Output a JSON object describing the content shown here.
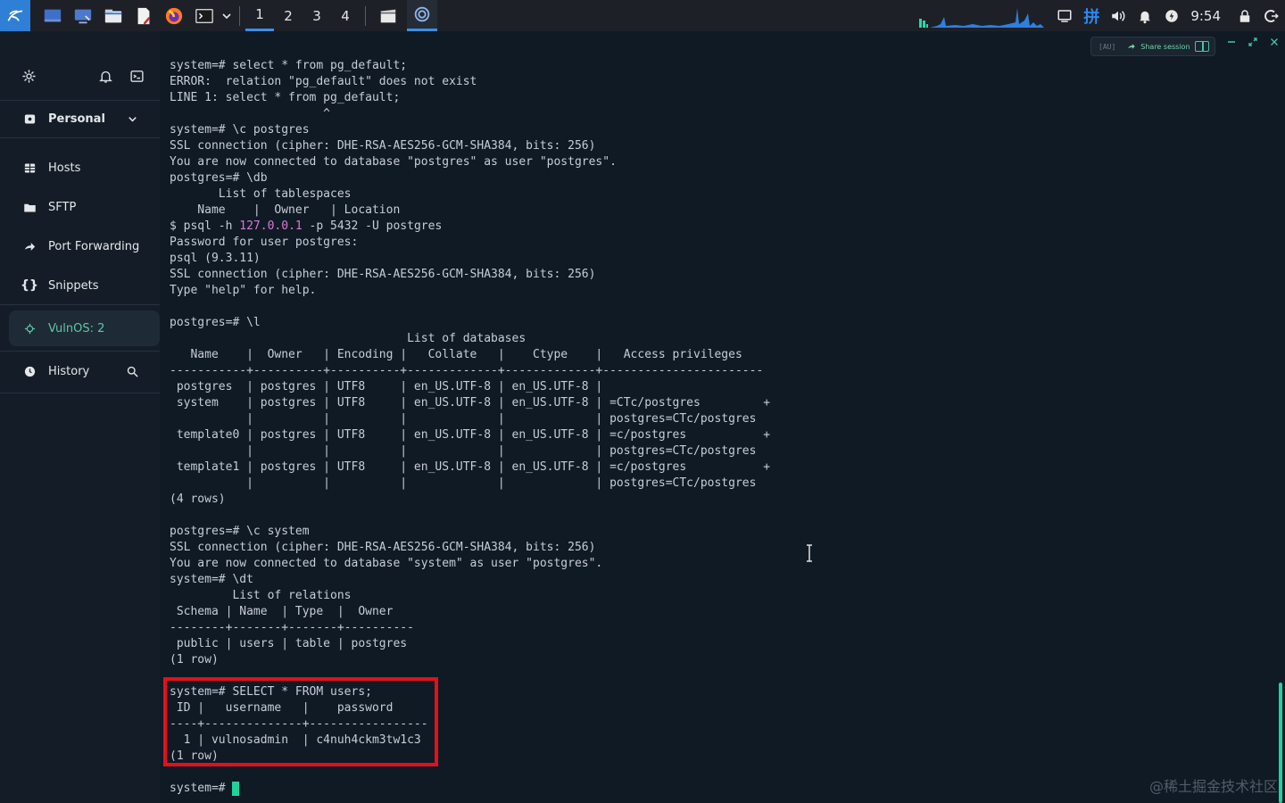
{
  "taskbar": {
    "workspaces": [
      "1",
      "2",
      "3",
      "4"
    ],
    "active_workspace": "1",
    "clock": "9:54",
    "ime_indicator": "拼",
    "accent": "#3d8ee6"
  },
  "sidebar": {
    "vault": "Personal",
    "items": [
      {
        "label": "Hosts",
        "icon": "hosts-grid-icon"
      },
      {
        "label": "SFTP",
        "icon": "folder-icon"
      },
      {
        "label": "Port Forwarding",
        "icon": "forward-arrow-icon"
      },
      {
        "label": "Snippets",
        "icon": "braces-icon"
      }
    ],
    "active_session": "VulnOS: 2",
    "history": "History",
    "active_color": "#5fc6a2"
  },
  "terminal": {
    "share_tag": "[AU]",
    "share_label": "Share session",
    "lines": [
      "system=# select * from pg_default;",
      "ERROR:  relation \"pg_default\" does not exist",
      "LINE 1: select * from pg_default;",
      "                      ^",
      "system=# \\c postgres",
      "SSL connection (cipher: DHE-RSA-AES256-GCM-SHA384, bits: 256)",
      "You are now connected to database \"postgres\" as user \"postgres\".",
      "postgres=# \\db",
      "       List of tablespaces",
      "    Name    |  Owner   | Location",
      "$ psql -h |127.0.0.1| -p 5432 -U postgres",
      "Password for user postgres:",
      "psql (9.3.11)",
      "SSL connection (cipher: DHE-RSA-AES256-GCM-SHA384, bits: 256)",
      "Type \"help\" for help.",
      "",
      "postgres=# \\l",
      "                                  List of databases",
      "   Name    |  Owner   | Encoding |   Collate   |    Ctype    |   Access privileges",
      "-----------+----------+----------+-------------+-------------+-----------------------",
      " postgres  | postgres | UTF8     | en_US.UTF-8 | en_US.UTF-8 |",
      " system    | postgres | UTF8     | en_US.UTF-8 | en_US.UTF-8 | =CTc/postgres         +",
      "           |          |          |             |             | postgres=CTc/postgres",
      " template0 | postgres | UTF8     | en_US.UTF-8 | en_US.UTF-8 | =c/postgres           +",
      "           |          |          |             |             | postgres=CTc/postgres",
      " template1 | postgres | UTF8     | en_US.UTF-8 | en_US.UTF-8 | =c/postgres           +",
      "           |          |          |             |             | postgres=CTc/postgres",
      "(4 rows)",
      "",
      "postgres=# \\c system",
      "SSL connection (cipher: DHE-RSA-AES256-GCM-SHA384, bits: 256)",
      "You are now connected to database \"system\" as user \"postgres\".",
      "system=# \\dt",
      "         List of relations",
      " Schema | Name  | Type  |  Owner",
      "--------+-------+-------+----------",
      " public | users | table | postgres",
      "(1 row)",
      "",
      "system=# SELECT * FROM users;",
      " ID |   username   |    password",
      "----+--------------+-----------------",
      "  1 | vulnosadmin  | c4nuh4ckm3tw1c3",
      "(1 row)",
      "",
      "system=# "
    ],
    "highlight_color": "#e3101a",
    "cursor_color": "#1ed39a"
  },
  "watermark": "@稀土掘金技术社区"
}
